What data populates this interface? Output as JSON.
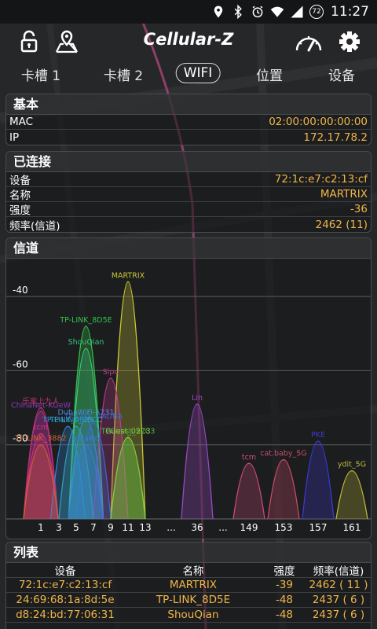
{
  "status_bar": {
    "battery_level": "72",
    "time": "11:27"
  },
  "app": {
    "title": "Cellular-Z"
  },
  "tabs": [
    {
      "label": "卡槽 1",
      "active": false
    },
    {
      "label": "卡槽 2",
      "active": false
    },
    {
      "label": "WIFI",
      "active": true
    },
    {
      "label": "位置",
      "active": false
    },
    {
      "label": "设备",
      "active": false
    }
  ],
  "basic": {
    "header": "基本",
    "rows": [
      {
        "key": "MAC",
        "value": "02:00:00:00:00:00"
      },
      {
        "key": "IP",
        "value": "172.17.78.2"
      }
    ]
  },
  "connected": {
    "header": "已连接",
    "rows": [
      {
        "key": "设备",
        "value": "72:1c:e7:c2:13:cf"
      },
      {
        "key": "名称",
        "value": "MARTRIX"
      },
      {
        "key": "强度",
        "value": "-36"
      },
      {
        "key": "频率(信道)",
        "value": "2462 (11)"
      }
    ]
  },
  "channel": {
    "header": "信道"
  },
  "chart_data": {
    "type": "area",
    "y_ticks": [
      -40,
      -60,
      -80
    ],
    "ylim": [
      -100,
      -30
    ],
    "x_ticks": [
      "1",
      "3",
      "5",
      "7",
      "9",
      "11",
      "13",
      "...",
      "36",
      "...",
      "149",
      "153",
      "157",
      "161"
    ],
    "grid": true,
    "series": [
      {
        "name": "MARTRIX",
        "channel": 11,
        "level": -36,
        "color": "#c8c83a"
      },
      {
        "name": "TP-LINK_8D5E",
        "channel": 6,
        "level": -48,
        "color": "#35c24a"
      },
      {
        "name": "ShouQian",
        "channel": 6,
        "level": -54,
        "color": "#39c47e"
      },
      {
        "name": "Sipo",
        "channel": 9,
        "level": -62,
        "color": "#c03a8e"
      },
      {
        "name": "ChinaNet-KGeW",
        "channel": 1,
        "level": -71,
        "color": "#8a3ab8"
      },
      {
        "name": "乐家上九人",
        "channel": 1,
        "level": -70,
        "color": "#c0306e"
      },
      {
        "name": "DubaWiFi-5231",
        "channel": 6,
        "level": -73,
        "color": "#4a8ad8"
      },
      {
        "name": "TP-LINK_AADBA",
        "channel": 7,
        "level": -74,
        "color": "#3a6ad0"
      },
      {
        "name": "TP-LINK_9E29",
        "channel": 4,
        "level": -75,
        "color": "#2f8ad8"
      },
      {
        "name": "TP-LINK_CBCC",
        "channel": 5,
        "level": -75,
        "color": "#35a0b8"
      },
      {
        "name": "TPGuest_52C3",
        "channel": 11,
        "level": -78,
        "color": "#3fb84a"
      },
      {
        "name": "Guest_02C3",
        "channel": 11,
        "level": -78,
        "color": "#8ac83a"
      },
      {
        "name": "tcm",
        "channel": 1,
        "level": -77,
        "color": "#d03080"
      },
      {
        "name": "aidawo",
        "channel": 6,
        "level": -80,
        "color": "#3a7ad8"
      },
      {
        "name": "TP-LINK_3882",
        "channel": 1,
        "level": -80,
        "color": "#d06030"
      },
      {
        "name": "Lin",
        "channel": 36,
        "level": -69,
        "color": "#9a4ac8"
      },
      {
        "name": "tcm",
        "channel": 149,
        "level": -85,
        "color": "#c84a7a"
      },
      {
        "name": "cat.baby_5G",
        "channel": 153,
        "level": -84,
        "color": "#c84a6a"
      },
      {
        "name": "PKE",
        "channel": 157,
        "level": -79,
        "color": "#3a3ad0"
      },
      {
        "name": "ydit_5G",
        "channel": 161,
        "level": -87,
        "color": "#b8b83a"
      }
    ]
  },
  "list": {
    "header": "列表",
    "columns": [
      "设备",
      "名称",
      "强度",
      "频率(信道)"
    ],
    "rows": [
      [
        "72:1c:e7:c2:13:cf",
        "MARTRIX",
        "-39",
        "2462 ( 11 )"
      ],
      [
        "24:69:68:1a:8d:5e",
        "TP-LINK_8D5E",
        "-48",
        "2437 (  6  )"
      ],
      [
        "d8:24:bd:77:06:31",
        "ShouQian",
        "-48",
        "2437 (  6  )"
      ]
    ]
  }
}
